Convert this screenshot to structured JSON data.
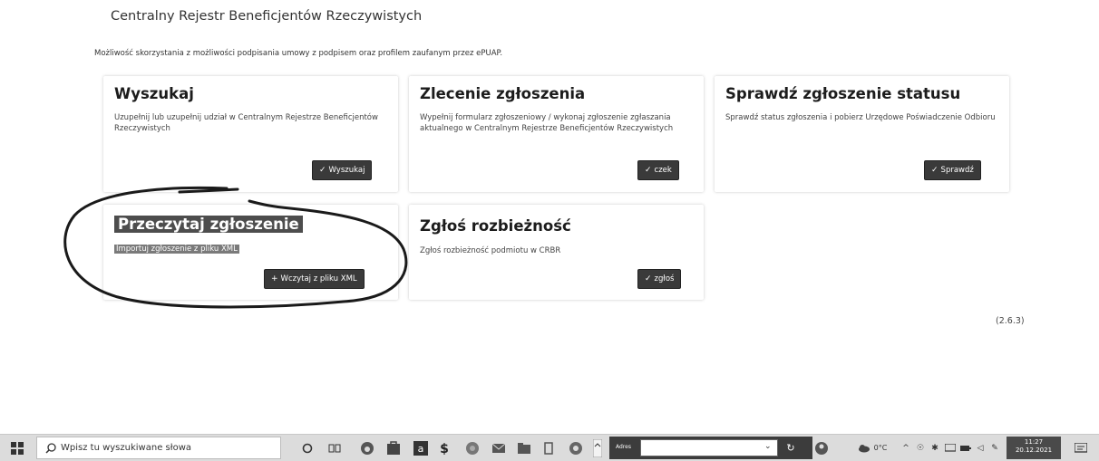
{
  "page": {
    "title": "Centralny Rejestr Beneficjentów Rzeczywistych",
    "info": "Możliwość skorzystania z możliwości podpisania umowy z podpisem oraz profilem zaufanym przez ePUAP.",
    "version": "(2.6.3)"
  },
  "cards": {
    "search": {
      "title": "Wyszukaj",
      "desc": "Uzupełnij lub uzupełnij udział w Centralnym Rejestrze Beneficjentów Rzeczywistych",
      "button": "Wyszukaj"
    },
    "order": {
      "title": "Zlecenie zgłoszenia",
      "desc": "Wypełnij formularz zgłoszeniowy / wykonaj zgłoszenie zgłaszania aktualnego w Centralnym Rejestrze Beneficjentów Rzeczywistych",
      "button": "czek"
    },
    "status": {
      "title": "Sprawdź zgłoszenie statusu",
      "desc": "Sprawdź status zgłoszenia i pobierz Urzędowe Poświadczenie Odbioru",
      "button": "Sprawdź"
    },
    "read": {
      "title": "Przeczytaj zgłoszenie",
      "desc": "Importuj zgłoszenie z pliku XML",
      "button": "Wczytaj z pliku XML"
    },
    "discrepancy": {
      "title": "Zgłoś rozbieżność",
      "desc": "Zgłoś rozbieżność podmiotu w CRBR",
      "button": "zgłoś"
    }
  },
  "taskbar": {
    "search_placeholder": "Wpisz tu wyszukiwane słowa",
    "address_label": "Adres",
    "weather": "0°C",
    "time": "11:27",
    "date": "20.12.2021"
  }
}
